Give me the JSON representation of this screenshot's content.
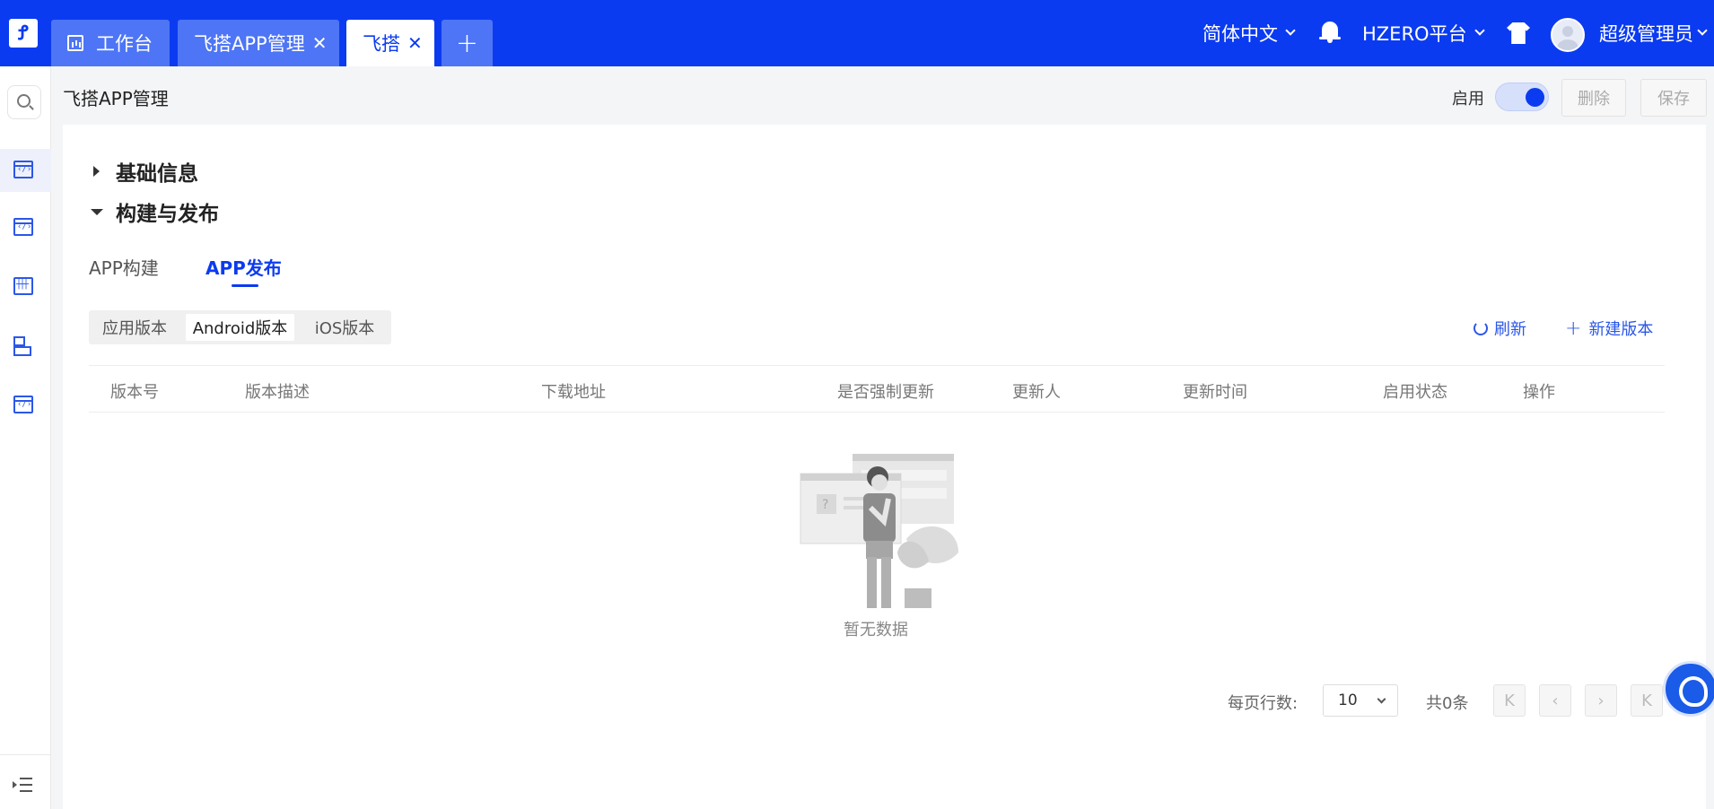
{
  "header": {
    "tabs": [
      {
        "label": "工作台"
      },
      {
        "label": "飞搭APP管理",
        "close": "✕"
      },
      {
        "label": "飞搭",
        "close": "✕"
      }
    ],
    "add_tab": "+",
    "language": "简体中文",
    "platform": "HZERO平台",
    "username": "超级管理员",
    "accent_color": "#0b3bf0"
  },
  "page": {
    "title": "飞搭APP管理",
    "enable_label": "启用",
    "enabled": true,
    "delete_label": "删除",
    "save_label": "保存"
  },
  "sections": {
    "basic_info": "基础信息",
    "build_publish": "构建与发布"
  },
  "subtabs": [
    {
      "label": "APP构建"
    },
    {
      "label": "APP发布"
    }
  ],
  "segments": [
    {
      "label": "应用版本"
    },
    {
      "label": "Android版本"
    },
    {
      "label": "iOS版本"
    }
  ],
  "actions": {
    "refresh": "刷新",
    "new_version": "新建版本"
  },
  "table": {
    "columns": [
      "版本号",
      "版本描述",
      "下载地址",
      "是否强制更新",
      "更新人",
      "更新时间",
      "启用状态",
      "操作"
    ],
    "empty_text": "暂无数据"
  },
  "pagination": {
    "rows_label": "每页行数:",
    "page_size": "10",
    "total": "共0条",
    "first": "K",
    "prev": "‹",
    "next": "›",
    "last": "K"
  }
}
